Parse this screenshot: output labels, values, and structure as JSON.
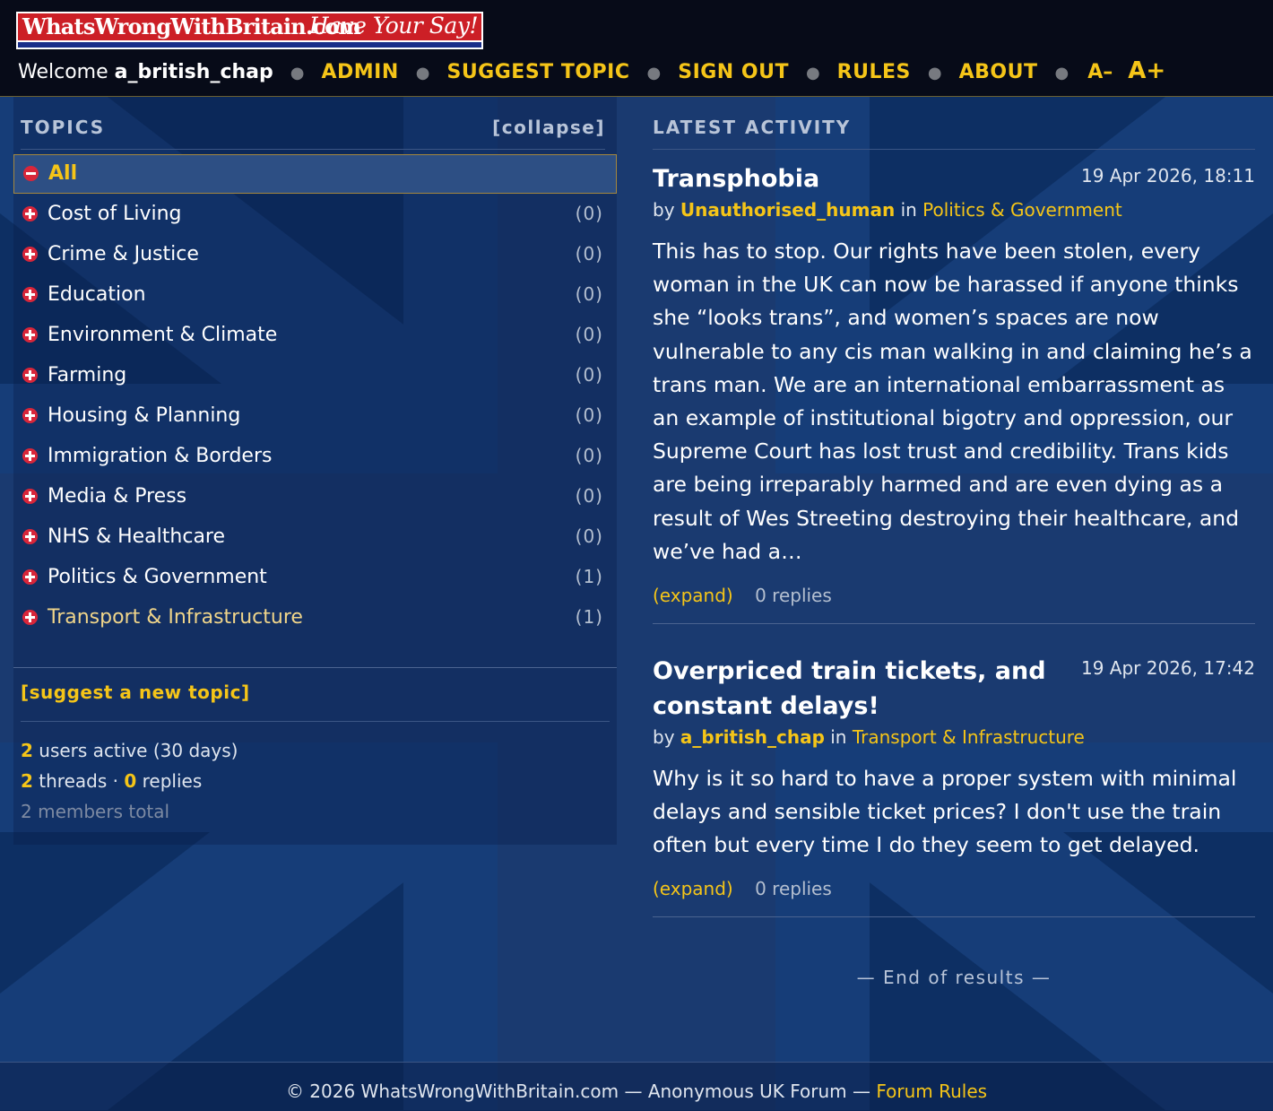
{
  "site": {
    "logo_text": "WhatsWrongWithBritain.com",
    "logo_tagline": "Have Your Say!"
  },
  "nav": {
    "welcome": "Welcome",
    "username": "a_british_chap",
    "links": [
      "ADMIN",
      "SUGGEST TOPIC",
      "SIGN OUT",
      "RULES",
      "ABOUT"
    ],
    "font_smaller": "A–",
    "font_larger": "A+"
  },
  "sidebar": {
    "title": "TOPICS",
    "collapse": "[collapse]",
    "topics": [
      {
        "name": "All",
        "count": ""
      },
      {
        "name": "Cost of Living",
        "count": "(0)"
      },
      {
        "name": "Crime & Justice",
        "count": "(0)"
      },
      {
        "name": "Education",
        "count": "(0)"
      },
      {
        "name": "Environment & Climate",
        "count": "(0)"
      },
      {
        "name": "Farming",
        "count": "(0)"
      },
      {
        "name": "Housing & Planning",
        "count": "(0)"
      },
      {
        "name": "Immigration & Borders",
        "count": "(0)"
      },
      {
        "name": "Media & Press",
        "count": "(0)"
      },
      {
        "name": "NHS & Healthcare",
        "count": "(0)"
      },
      {
        "name": "Politics & Government",
        "count": "(1)"
      },
      {
        "name": "Transport & Infrastructure",
        "count": "(1)"
      }
    ],
    "suggest": "[suggest a new topic]",
    "stats": {
      "users_count": "2",
      "users_label": "users active (30 days)",
      "threads_count": "2",
      "threads_label": "threads",
      "dot": "·",
      "replies_count": "0",
      "replies_label": "replies",
      "members": "2 members total"
    }
  },
  "activity": {
    "title": "LATEST ACTIVITY",
    "by_label": "by",
    "in_label": "in",
    "posts": [
      {
        "title": "Transphobia",
        "date": "19 Apr 2026, 18:11",
        "author": "Unauthorised_human",
        "category": "Politics & Government",
        "body": "This has to stop. Our rights have been stolen, every woman in the UK can now be harassed if anyone thinks she “looks trans”, and women’s spaces are now vulnerable to any cis man walking in and claiming he’s a trans man. We are an international embarrassment as an example of institutional bigotry and oppression, our Supreme Court has lost trust and credibility. Trans kids are being irreparably harmed and are even dying as a result of Wes Streeting destroying their healthcare, and we’ve had a…",
        "expand": "(expand)",
        "replies": "0 replies"
      },
      {
        "title": "Overpriced train tickets, and constant delays!",
        "date": "19 Apr 2026, 17:42",
        "author": "a_british_chap",
        "category": "Transport & Infrastructure",
        "body": "Why is it so hard to have a proper system with minimal delays and sensible ticket prices? I don't use the train often but every time I do they seem to get delayed.",
        "expand": "(expand)",
        "replies": "0 replies"
      }
    ],
    "end": "— End of results —"
  },
  "footer": {
    "text": "© 2026 WhatsWrongWithBritain.com — Anonymous UK Forum —",
    "rules_link": "Forum Rules"
  },
  "colors": {
    "background": "#0f3060",
    "header": "#070b18",
    "accent": "#f5c518",
    "flag_red": "#d8263a"
  }
}
